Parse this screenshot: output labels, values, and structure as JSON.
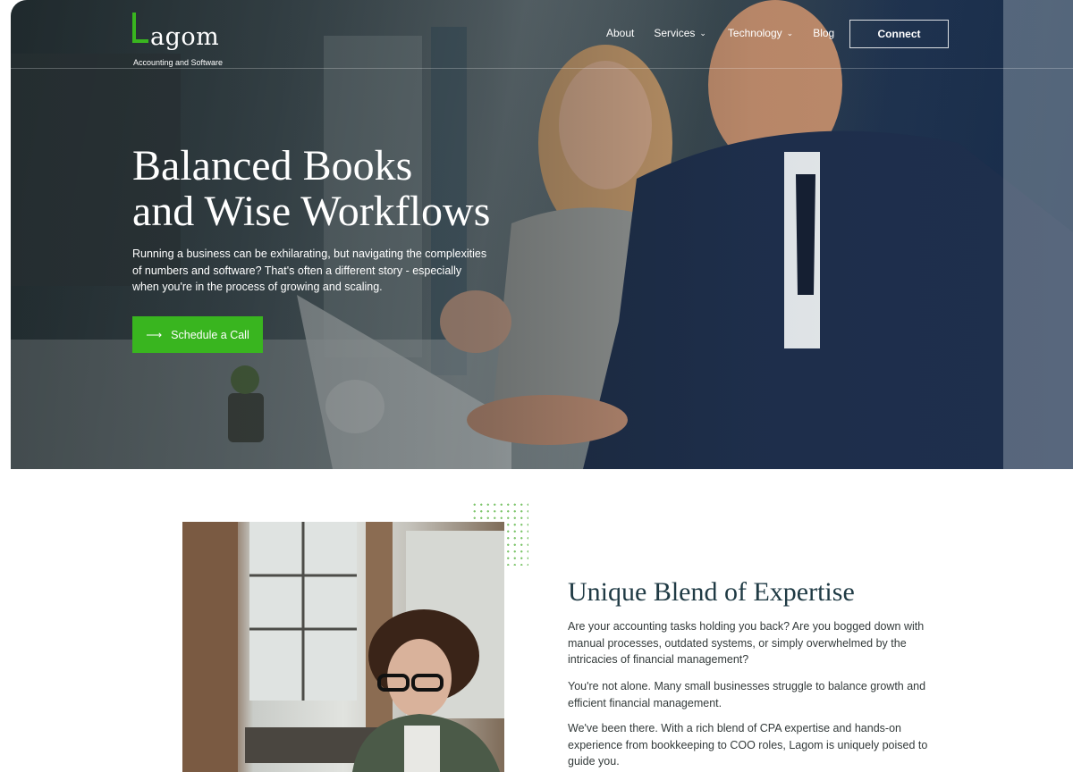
{
  "brand": {
    "name": "agom",
    "tagline": "Accounting and Software",
    "accent_color": "#39b51f"
  },
  "nav": {
    "items": [
      {
        "label": "About",
        "has_dropdown": false
      },
      {
        "label": "Services",
        "has_dropdown": true
      },
      {
        "label": "Technology",
        "has_dropdown": true
      },
      {
        "label": "Blog",
        "has_dropdown": false
      }
    ],
    "connect_label": "Connect"
  },
  "hero": {
    "title_line1": "Balanced Books",
    "title_line2": "and Wise Workflows",
    "text": "Running a business can be exhilarating, but navigating the complexities of numbers and software? That's often a different story - especially when you're in the process of growing and scaling.",
    "cta_icon": "arrow-right-icon",
    "cta_label": "Schedule a Call"
  },
  "expertise": {
    "title": "Unique Blend of Expertise",
    "paragraphs": [
      "Are your accounting tasks holding you back? Are you bogged down with manual processes, outdated systems, or simply overwhelmed by the intricacies of financial management?",
      "You're not alone. Many small businesses struggle to balance growth and efficient financial management.",
      "We've been there. With a rich blend of CPA expertise and hands-on experience from bookkeeping to COO roles, Lagom is uniquely poised to guide you."
    ]
  }
}
